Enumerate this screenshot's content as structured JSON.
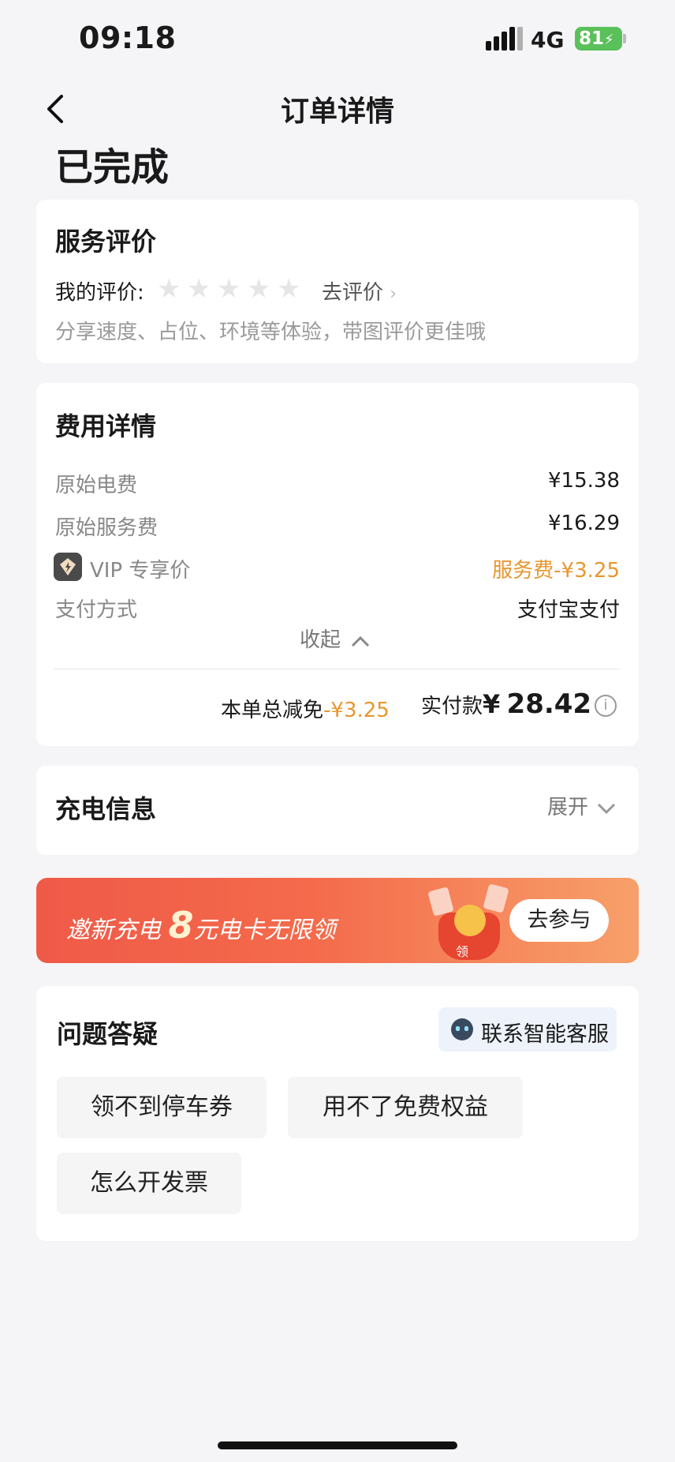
{
  "status_bar": {
    "time": "09:18",
    "network": "4G",
    "battery": "81"
  },
  "nav": {
    "title": "订单详情"
  },
  "order_status": "已完成",
  "rating": {
    "title": "服务评价",
    "label": "我的评价:",
    "stars_filled": 0,
    "stars_total": 5,
    "action": "去评价",
    "hint": "分享速度、占位、环境等体验，带图评价更佳哦"
  },
  "fees": {
    "title": "费用详情",
    "rows": [
      {
        "label": "原始电费",
        "value": "¥15.38"
      },
      {
        "label": "原始服务费",
        "value": "¥16.29"
      },
      {
        "label": "VIP 专享价",
        "value": "服务费-¥3.25"
      },
      {
        "label": "支付方式",
        "value": "支付宝支付"
      }
    ],
    "collapse_label": "收起",
    "total_discount_label": "本单总减免",
    "total_discount_value": "-¥3.25",
    "paid_label": "实付款",
    "paid_currency": "¥",
    "paid_value": "28.42"
  },
  "charging": {
    "title": "充电信息",
    "expand_label": "展开"
  },
  "banner": {
    "text_prefix": "邀新充电",
    "highlight": "8",
    "text_suffix": "元电卡无限领",
    "button": "去参与",
    "badge": "领"
  },
  "faq": {
    "title": "问题答疑",
    "contact_label": "联系智能客服",
    "chips": [
      "领不到停车券",
      "用不了免费权益",
      "怎么开发票"
    ]
  },
  "colors": {
    "accent": "#e8962e",
    "banner_start": "#ef5a48",
    "banner_end": "#f7a06a",
    "battery": "#5ac05a"
  }
}
